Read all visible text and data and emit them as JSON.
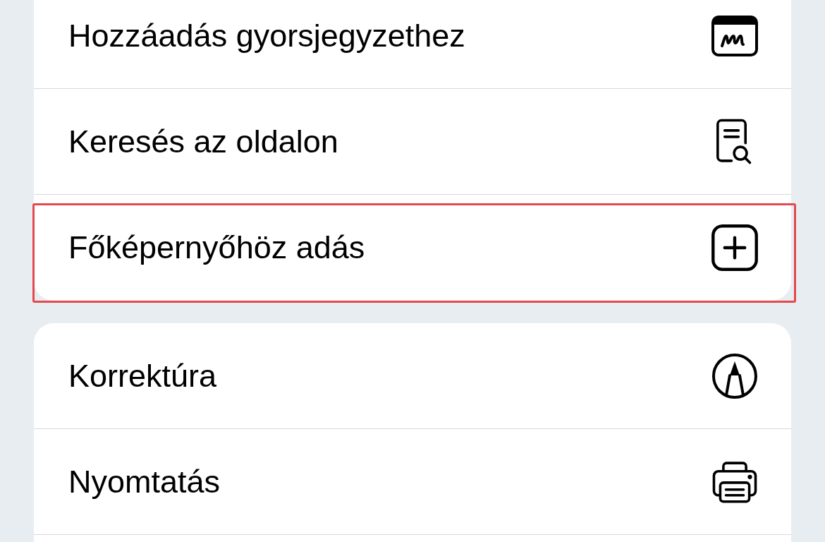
{
  "groups": [
    {
      "items": [
        {
          "label": "Hozzáadás gyorsjegyzethez",
          "kind": "quicknote",
          "highlighted": false
        },
        {
          "label": "Keresés az oldalon",
          "kind": "findpage",
          "highlighted": false
        },
        {
          "label": "Főképernyőhöz adás",
          "kind": "addsquare",
          "highlighted": true
        }
      ]
    },
    {
      "items": [
        {
          "label": "Korrektúra",
          "kind": "markup",
          "highlighted": false
        },
        {
          "label": "Nyomtatás",
          "kind": "printer",
          "highlighted": false
        }
      ]
    }
  ]
}
